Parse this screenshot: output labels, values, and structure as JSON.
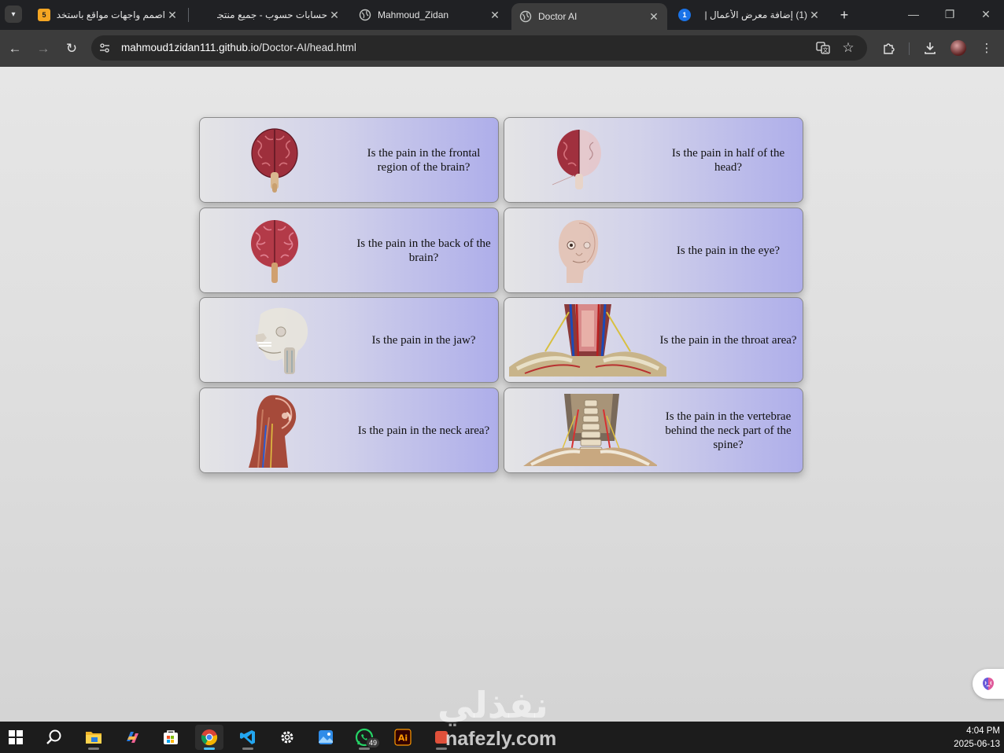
{
  "browser": {
    "tabs": [
      {
        "title": "اصمم واجهات مواقع باستخدام",
        "favicon_text": "5",
        "favicon_color": "#f5a623",
        "active": false
      },
      {
        "title": "حسابات حسوب - جميع منتجات",
        "favicon_text": "",
        "favicon_color": "#202124",
        "active": false
      },
      {
        "title": "Mahmoud_Zidan",
        "favicon_text": "",
        "favicon_color": "#e3e3e3",
        "active": false
      },
      {
        "title": "Doctor AI",
        "favicon_text": "",
        "favicon_color": "#e3e3e3",
        "active": true
      },
      {
        "title": "(1) إضافة معرض الأعمال |",
        "favicon_text": "1",
        "favicon_color": "#1a73e8",
        "active": false
      }
    ],
    "address": {
      "host": "mahmoud1zidan111.github.io",
      "path": "/Doctor-AI/head.html"
    }
  },
  "page": {
    "cards": [
      {
        "question": "Is the pain in the frontal region of the brain?",
        "image": "brain-front-icon"
      },
      {
        "question": "Is the pain in half of the head?",
        "image": "brain-half-icon"
      },
      {
        "question": "Is the pain in the back of the brain?",
        "image": "brain-back-icon"
      },
      {
        "question": "Is the pain in the eye?",
        "image": "head-eye-icon"
      },
      {
        "question": "Is the pain in the jaw?",
        "image": "skull-jaw-icon"
      },
      {
        "question": "Is the pain in the throat area?",
        "image": "throat-anatomy-icon"
      },
      {
        "question": "Is the pain in the neck area?",
        "image": "neck-anatomy-icon"
      },
      {
        "question": "Is the pain in the vertebrae behind the neck part of the spine?",
        "image": "cervical-spine-icon"
      }
    ]
  },
  "taskbar": {
    "whatsapp_badge": "49",
    "time": "4:04 PM",
    "date": "2025-06-13"
  },
  "watermark": {
    "arabic": "نفذلي",
    "latin": "nafezly.com"
  },
  "colors": {
    "accent": "#4cc2ff",
    "card_gradient_end": "#aeaeea",
    "page_background": "#e0e0e0"
  }
}
